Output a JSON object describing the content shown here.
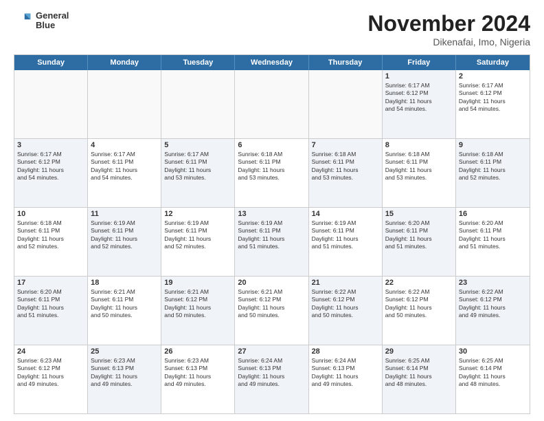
{
  "header": {
    "logo_line1": "General",
    "logo_line2": "Blue",
    "month": "November 2024",
    "location": "Dikenafai, Imo, Nigeria"
  },
  "weekdays": [
    "Sunday",
    "Monday",
    "Tuesday",
    "Wednesday",
    "Thursday",
    "Friday",
    "Saturday"
  ],
  "rows": [
    [
      {
        "day": "",
        "detail": "",
        "empty": true
      },
      {
        "day": "",
        "detail": "",
        "empty": true
      },
      {
        "day": "",
        "detail": "",
        "empty": true
      },
      {
        "day": "",
        "detail": "",
        "empty": true
      },
      {
        "day": "",
        "detail": "",
        "empty": true
      },
      {
        "day": "1",
        "detail": "Sunrise: 6:17 AM\nSunset: 6:12 PM\nDaylight: 11 hours\nand 54 minutes.",
        "shaded": true
      },
      {
        "day": "2",
        "detail": "Sunrise: 6:17 AM\nSunset: 6:12 PM\nDaylight: 11 hours\nand 54 minutes.",
        "shaded": false
      }
    ],
    [
      {
        "day": "3",
        "detail": "Sunrise: 6:17 AM\nSunset: 6:12 PM\nDaylight: 11 hours\nand 54 minutes.",
        "shaded": true
      },
      {
        "day": "4",
        "detail": "Sunrise: 6:17 AM\nSunset: 6:11 PM\nDaylight: 11 hours\nand 54 minutes.",
        "shaded": false
      },
      {
        "day": "5",
        "detail": "Sunrise: 6:17 AM\nSunset: 6:11 PM\nDaylight: 11 hours\nand 53 minutes.",
        "shaded": true
      },
      {
        "day": "6",
        "detail": "Sunrise: 6:18 AM\nSunset: 6:11 PM\nDaylight: 11 hours\nand 53 minutes.",
        "shaded": false
      },
      {
        "day": "7",
        "detail": "Sunrise: 6:18 AM\nSunset: 6:11 PM\nDaylight: 11 hours\nand 53 minutes.",
        "shaded": true
      },
      {
        "day": "8",
        "detail": "Sunrise: 6:18 AM\nSunset: 6:11 PM\nDaylight: 11 hours\nand 53 minutes.",
        "shaded": false
      },
      {
        "day": "9",
        "detail": "Sunrise: 6:18 AM\nSunset: 6:11 PM\nDaylight: 11 hours\nand 52 minutes.",
        "shaded": true
      }
    ],
    [
      {
        "day": "10",
        "detail": "Sunrise: 6:18 AM\nSunset: 6:11 PM\nDaylight: 11 hours\nand 52 minutes.",
        "shaded": false
      },
      {
        "day": "11",
        "detail": "Sunrise: 6:19 AM\nSunset: 6:11 PM\nDaylight: 11 hours\nand 52 minutes.",
        "shaded": true
      },
      {
        "day": "12",
        "detail": "Sunrise: 6:19 AM\nSunset: 6:11 PM\nDaylight: 11 hours\nand 52 minutes.",
        "shaded": false
      },
      {
        "day": "13",
        "detail": "Sunrise: 6:19 AM\nSunset: 6:11 PM\nDaylight: 11 hours\nand 51 minutes.",
        "shaded": true
      },
      {
        "day": "14",
        "detail": "Sunrise: 6:19 AM\nSunset: 6:11 PM\nDaylight: 11 hours\nand 51 minutes.",
        "shaded": false
      },
      {
        "day": "15",
        "detail": "Sunrise: 6:20 AM\nSunset: 6:11 PM\nDaylight: 11 hours\nand 51 minutes.",
        "shaded": true
      },
      {
        "day": "16",
        "detail": "Sunrise: 6:20 AM\nSunset: 6:11 PM\nDaylight: 11 hours\nand 51 minutes.",
        "shaded": false
      }
    ],
    [
      {
        "day": "17",
        "detail": "Sunrise: 6:20 AM\nSunset: 6:11 PM\nDaylight: 11 hours\nand 51 minutes.",
        "shaded": true
      },
      {
        "day": "18",
        "detail": "Sunrise: 6:21 AM\nSunset: 6:11 PM\nDaylight: 11 hours\nand 50 minutes.",
        "shaded": false
      },
      {
        "day": "19",
        "detail": "Sunrise: 6:21 AM\nSunset: 6:12 PM\nDaylight: 11 hours\nand 50 minutes.",
        "shaded": true
      },
      {
        "day": "20",
        "detail": "Sunrise: 6:21 AM\nSunset: 6:12 PM\nDaylight: 11 hours\nand 50 minutes.",
        "shaded": false
      },
      {
        "day": "21",
        "detail": "Sunrise: 6:22 AM\nSunset: 6:12 PM\nDaylight: 11 hours\nand 50 minutes.",
        "shaded": true
      },
      {
        "day": "22",
        "detail": "Sunrise: 6:22 AM\nSunset: 6:12 PM\nDaylight: 11 hours\nand 50 minutes.",
        "shaded": false
      },
      {
        "day": "23",
        "detail": "Sunrise: 6:22 AM\nSunset: 6:12 PM\nDaylight: 11 hours\nand 49 minutes.",
        "shaded": true
      }
    ],
    [
      {
        "day": "24",
        "detail": "Sunrise: 6:23 AM\nSunset: 6:12 PM\nDaylight: 11 hours\nand 49 minutes.",
        "shaded": false
      },
      {
        "day": "25",
        "detail": "Sunrise: 6:23 AM\nSunset: 6:13 PM\nDaylight: 11 hours\nand 49 minutes.",
        "shaded": true
      },
      {
        "day": "26",
        "detail": "Sunrise: 6:23 AM\nSunset: 6:13 PM\nDaylight: 11 hours\nand 49 minutes.",
        "shaded": false
      },
      {
        "day": "27",
        "detail": "Sunrise: 6:24 AM\nSunset: 6:13 PM\nDaylight: 11 hours\nand 49 minutes.",
        "shaded": true
      },
      {
        "day": "28",
        "detail": "Sunrise: 6:24 AM\nSunset: 6:13 PM\nDaylight: 11 hours\nand 49 minutes.",
        "shaded": false
      },
      {
        "day": "29",
        "detail": "Sunrise: 6:25 AM\nSunset: 6:14 PM\nDaylight: 11 hours\nand 48 minutes.",
        "shaded": true
      },
      {
        "day": "30",
        "detail": "Sunrise: 6:25 AM\nSunset: 6:14 PM\nDaylight: 11 hours\nand 48 minutes.",
        "shaded": false
      }
    ]
  ]
}
